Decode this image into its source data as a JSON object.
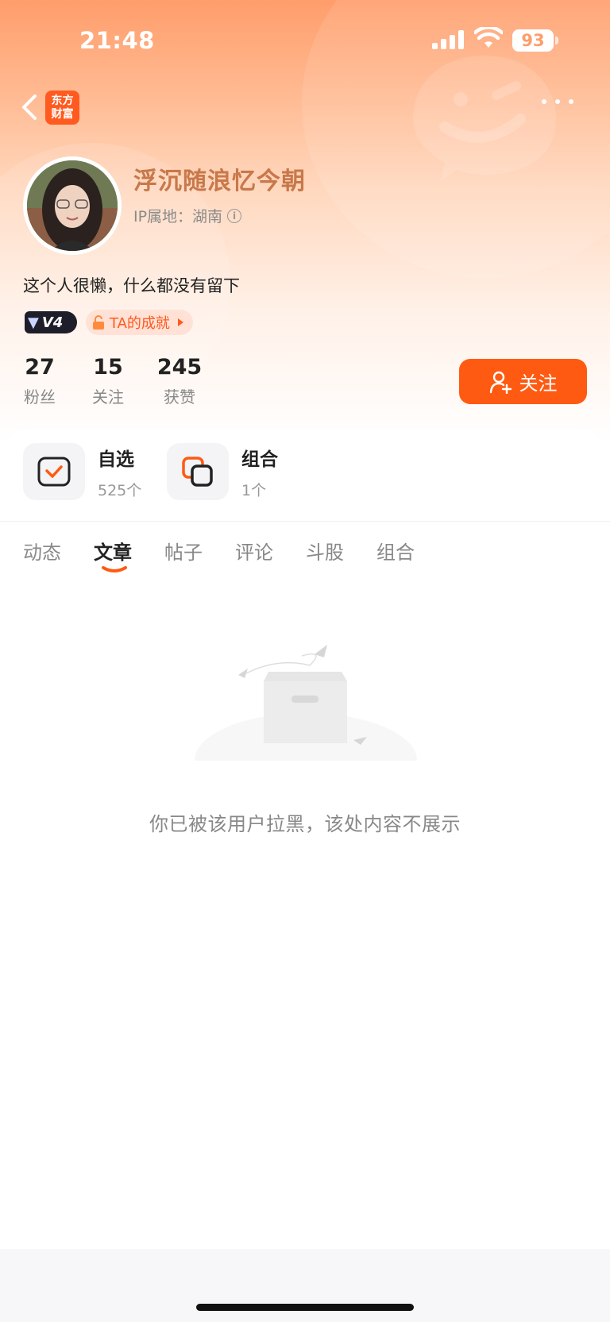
{
  "status_bar": {
    "time": "21:48",
    "battery": "93"
  },
  "header": {
    "logo_line1": "东方",
    "logo_line2": "财富"
  },
  "profile": {
    "username": "浮沉随浪忆今朝",
    "ip_location": "IP属地：湖南",
    "bio": "这个人很懒，什么都没有留下",
    "level": "V4",
    "achievement_label": "TA的成就"
  },
  "stats": [
    {
      "value": "27",
      "label": "粉丝"
    },
    {
      "value": "15",
      "label": "关注"
    },
    {
      "value": "245",
      "label": "获赞"
    }
  ],
  "follow_button": {
    "label": "关注"
  },
  "quick_links": [
    {
      "title": "自选",
      "count": "525个"
    },
    {
      "title": "组合",
      "count": "1个"
    }
  ],
  "tabs": [
    {
      "label": "动态"
    },
    {
      "label": "文章",
      "active": true
    },
    {
      "label": "帖子"
    },
    {
      "label": "评论"
    },
    {
      "label": "斗股"
    },
    {
      "label": "组合"
    }
  ],
  "empty_state": {
    "message": "你已被该用户拉黑，该处内容不展示"
  },
  "colors": {
    "accent": "#ff5a12",
    "username": "#c8784a"
  }
}
